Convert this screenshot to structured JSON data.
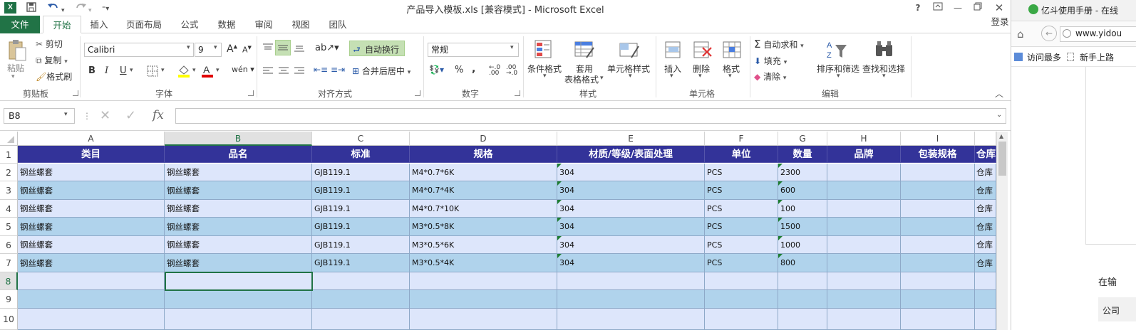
{
  "app": {
    "title": "产品导入模板.xls  [兼容模式] - Microsoft Excel",
    "logo": "X",
    "login": "登录",
    "help": "?"
  },
  "tabs": [
    "文件",
    "开始",
    "插入",
    "页面布局",
    "公式",
    "数据",
    "审阅",
    "视图",
    "团队"
  ],
  "active_tab": "开始",
  "ribbon": {
    "clipboard": {
      "paste": "粘贴",
      "cut": "剪切",
      "copy": "复制",
      "format_painter": "格式刷",
      "label": "剪贴板"
    },
    "font": {
      "name": "Calibri",
      "size": "9",
      "bold": "B",
      "italic": "I",
      "underline": "U",
      "label": "字体"
    },
    "alignment": {
      "wrap": "自动换行",
      "merge": "合并后居中",
      "label": "对齐方式"
    },
    "number": {
      "format": "常规",
      "percent": "%",
      "comma": ",",
      "label": "数字"
    },
    "styles": {
      "conditional": "条件格式",
      "table_format_1": "套用",
      "table_format_2": "表格格式",
      "cell_styles": "单元格样式",
      "label": "样式"
    },
    "cells": {
      "insert": "插入",
      "delete": "删除",
      "format": "格式",
      "label": "单元格"
    },
    "editing": {
      "autosum": "自动求和",
      "fill": "填充",
      "clear": "清除",
      "sort": "排序和筛选",
      "find": "查找和选择",
      "label": "编辑"
    }
  },
  "formula_bar": {
    "name_box": "B8",
    "fx": "fx",
    "formula": ""
  },
  "sheet": {
    "columns": [
      "A",
      "B",
      "C",
      "D",
      "E",
      "F",
      "G",
      "H",
      "I"
    ],
    "selected_column": "B",
    "selected_row": "8",
    "rows": [
      "1",
      "2",
      "3",
      "4",
      "5",
      "6",
      "7",
      "8",
      "9",
      "10"
    ],
    "header": [
      "类目",
      "品名",
      "标准",
      "规格",
      "材质/等级/表面处理",
      "单位",
      "数量",
      "品牌",
      "包装规格",
      "仓库"
    ],
    "data": [
      [
        "钢丝螺套",
        "钢丝螺套",
        "GJB119.1",
        "M4*0.7*6K",
        "304",
        "PCS",
        "2300",
        "",
        "",
        "仓库"
      ],
      [
        "钢丝螺套",
        "钢丝螺套",
        "GJB119.1",
        "M4*0.7*4K",
        "304",
        "PCS",
        "600",
        "",
        "",
        "仓库"
      ],
      [
        "钢丝螺套",
        "钢丝螺套",
        "GJB119.1",
        "M4*0.7*10K",
        "304",
        "PCS",
        "100",
        "",
        "",
        "仓库"
      ],
      [
        "钢丝螺套",
        "钢丝螺套",
        "GJB119.1",
        "M3*0.5*8K",
        "304",
        "PCS",
        "1500",
        "",
        "",
        "仓库"
      ],
      [
        "钢丝螺套",
        "钢丝螺套",
        "GJB119.1",
        "M3*0.5*6K",
        "304",
        "PCS",
        "1000",
        "",
        "",
        "仓库"
      ],
      [
        "钢丝螺套",
        "钢丝螺套",
        "GJB119.1",
        "M3*0.5*4K",
        "304",
        "PCS",
        "800",
        "",
        "",
        "仓库"
      ],
      [
        "",
        "",
        "",
        "",
        "",
        "",
        "",
        "",
        "",
        ""
      ],
      [
        "",
        "",
        "",
        "",
        "",
        "",
        "",
        "",
        "",
        ""
      ],
      [
        "",
        "",
        "",
        "",
        "",
        "",
        "",
        "",
        "",
        ""
      ]
    ],
    "colors": {
      "header_bg": "#333399",
      "row_light": "#dde6fb",
      "row_dark": "#b0d3ec",
      "accent": "#217346"
    }
  },
  "browser": {
    "tab_title": "亿斗使用手册 - 在线",
    "url": "www.yidou",
    "bookmark_1": "访问最多",
    "bookmark_2": "新手上路",
    "body_text_1": "在输",
    "body_text_2": "公司"
  }
}
